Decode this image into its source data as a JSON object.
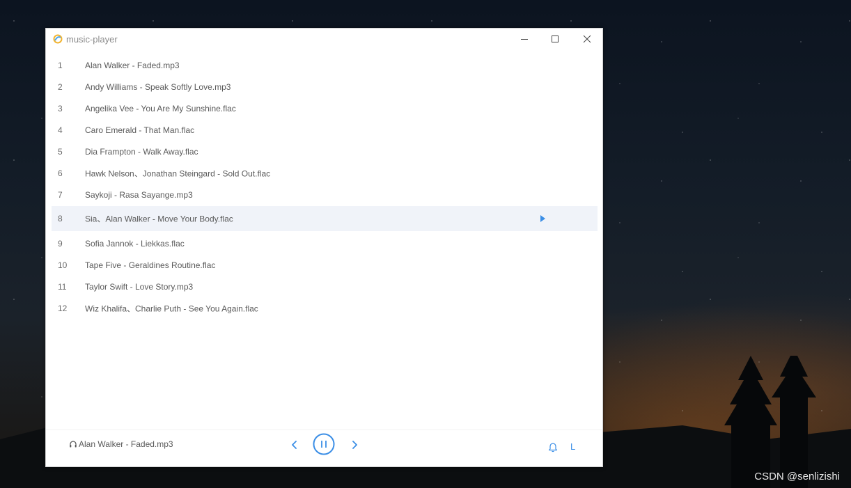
{
  "window": {
    "title": "music-player"
  },
  "playlist": [
    {
      "index": "1",
      "name": "Alan Walker - Faded.mp3"
    },
    {
      "index": "2",
      "name": "Andy Williams - Speak Softly Love.mp3"
    },
    {
      "index": "3",
      "name": "Angelika Vee - You Are My Sunshine.flac"
    },
    {
      "index": "4",
      "name": "Caro Emerald - That Man.flac"
    },
    {
      "index": "5",
      "name": "Dia Frampton - Walk Away.flac"
    },
    {
      "index": "6",
      "name": "Hawk Nelson、Jonathan Steingard - Sold Out.flac"
    },
    {
      "index": "7",
      "name": "Saykoji - Rasa Sayange.mp3"
    },
    {
      "index": "8",
      "name": "Sia、Alan Walker - Move Your Body.flac"
    },
    {
      "index": "9",
      "name": "Sofia Jannok - Liekkas.flac"
    },
    {
      "index": "10",
      "name": "Tape Five - Geraldines Routine.flac"
    },
    {
      "index": "11",
      "name": "Taylor Swift - Love Story.mp3"
    },
    {
      "index": "12",
      "name": "Wiz Khalifa、Charlie Puth - See You Again.flac"
    }
  ],
  "highlighted_row": 8,
  "player": {
    "now_playing": "Alan Walker - Faded.mp3",
    "loop_mode": "L",
    "state": "playing"
  },
  "watermark": "CSDN @senlizishi",
  "colors": {
    "accent": "#3b8ee6",
    "row_highlight": "#f0f3f9",
    "text": "#5a5a5a"
  },
  "icons": [
    "app-logo-icon",
    "minimize-icon",
    "maximize-icon",
    "close-icon",
    "play-indicator-icon",
    "headphone-icon",
    "previous-icon",
    "pause-icon",
    "next-icon",
    "bell-icon"
  ]
}
